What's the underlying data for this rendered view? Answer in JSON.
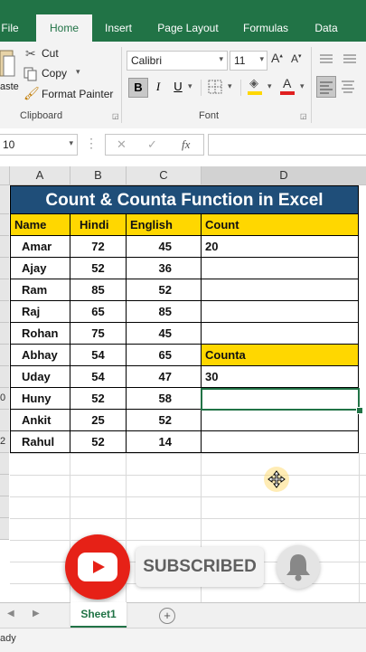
{
  "ribbon": {
    "tabs": [
      "File",
      "Home",
      "Insert",
      "Page Layout",
      "Formulas",
      "Data"
    ],
    "clipboard": {
      "paste_partial": "aste",
      "cut": "Cut",
      "copy": "Copy",
      "format_painter": "Format Painter",
      "group_label": "Clipboard"
    },
    "font": {
      "family": "Calibri",
      "size": "11",
      "grow": "A",
      "shrink": "A",
      "bold": "B",
      "italic": "I",
      "underline": "U",
      "font_color_letter": "A",
      "group_label": "Font"
    }
  },
  "formula_bar": {
    "name_box": "10",
    "cancel": "✕",
    "enter": "✓",
    "fx": "fx",
    "content": ""
  },
  "grid": {
    "columns": [
      "A",
      "B",
      "C",
      "D"
    ],
    "row_numbers": [
      "",
      "",
      "",
      "",
      "",
      "",
      "",
      "",
      "",
      "0",
      "",
      "2",
      "",
      "",
      "",
      ""
    ],
    "title": "Count & Counta Function in Excel",
    "headers": [
      "Name",
      "Hindi",
      "English",
      "Count"
    ],
    "rows": [
      [
        "Amar",
        "72",
        "45",
        "20"
      ],
      [
        "Ajay",
        "52",
        "36",
        ""
      ],
      [
        "Ram",
        "85",
        "52",
        ""
      ],
      [
        "Raj",
        "65",
        "85",
        ""
      ],
      [
        "Rohan",
        "75",
        "45",
        ""
      ],
      [
        "Abhay",
        "54",
        "65",
        "Counta"
      ],
      [
        "Uday",
        "54",
        "47",
        "30"
      ],
      [
        "Huny",
        "52",
        "58",
        ""
      ],
      [
        "Ankit",
        "25",
        "52",
        ""
      ],
      [
        "Rahul",
        "52",
        "14",
        ""
      ]
    ]
  },
  "overlay": {
    "subscribed": "SUBSCRIBED"
  },
  "sheets": {
    "active": "Sheet1",
    "add": "+"
  },
  "status": {
    "text": "ady"
  },
  "colors": {
    "excel_green": "#217346",
    "title_bg": "#1f4e79",
    "header_yellow": "#ffd700",
    "youtube_red": "#e62117"
  }
}
